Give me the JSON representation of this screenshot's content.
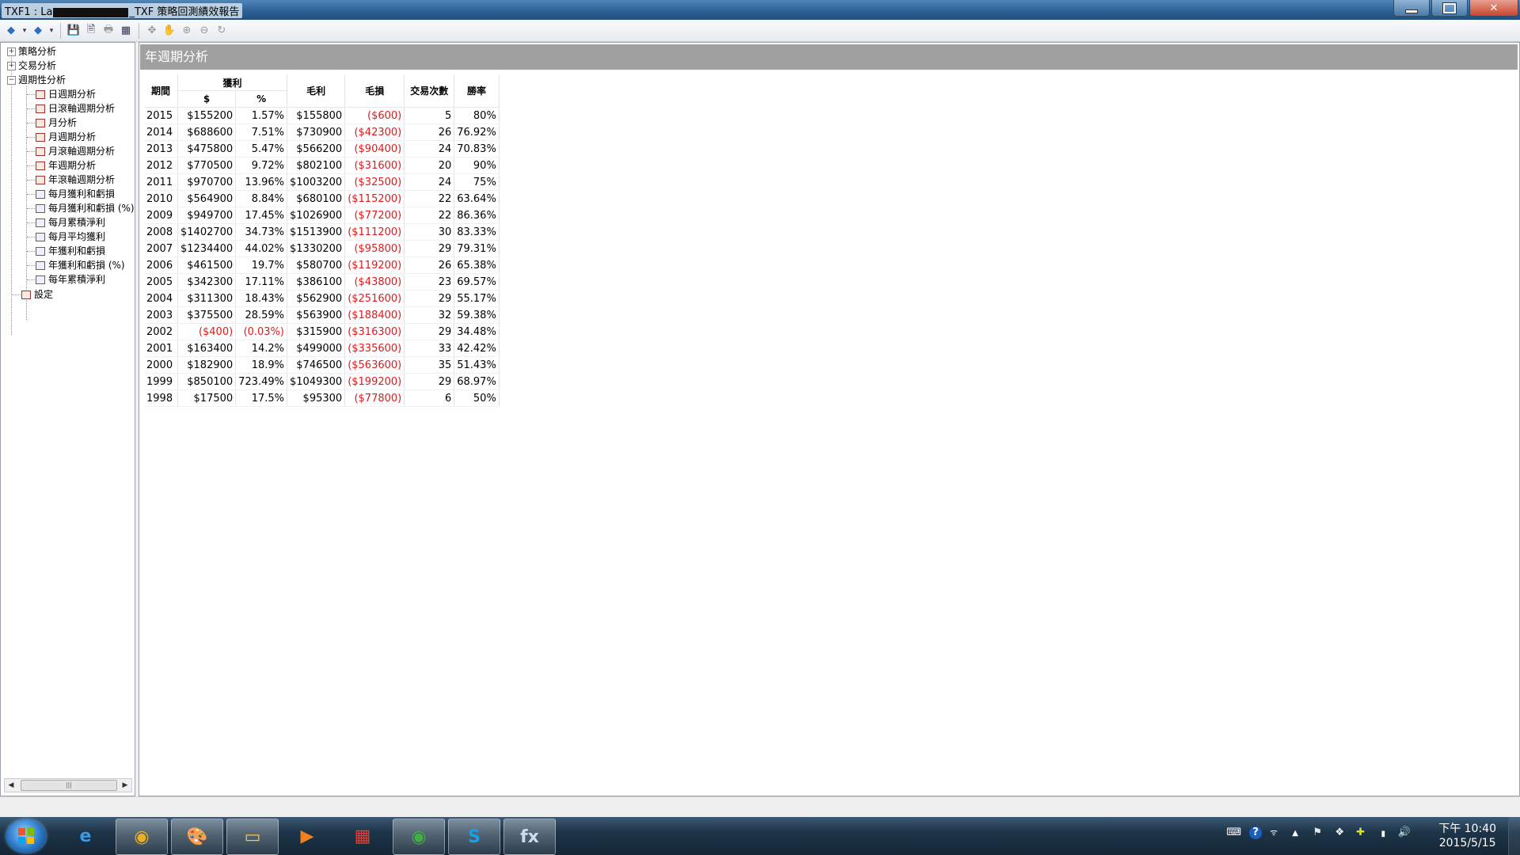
{
  "window": {
    "title_prefix": "TXF1 : La",
    "title_suffix": "_TXF 策略回測績效報告",
    "min_icon": "minimize-icon",
    "max_icon": "maximize-icon",
    "close_glyph": "✕"
  },
  "toolbar": {
    "back_glyph": "◆",
    "forward_glyph": "◆",
    "drop_glyph": "▾",
    "save_glyph": "💾",
    "doc_glyph": "🗎",
    "print_glyph": "🖶",
    "layout_glyph": "▦",
    "arrow_glyph": "✥",
    "hand_glyph": "✋",
    "zoom_in_glyph": "⊕",
    "zoom_out_glyph": "⊖",
    "refresh_glyph": "↻"
  },
  "tree": {
    "roots": [
      {
        "label": "策略分析",
        "exp": "+"
      },
      {
        "label": "交易分析",
        "exp": "+"
      },
      {
        "label": "週期性分析",
        "exp": "−"
      }
    ],
    "children": [
      {
        "label": "日週期分析",
        "icon": "table"
      },
      {
        "label": "日滾軸週期分析",
        "icon": "table"
      },
      {
        "label": "月分析",
        "icon": "table"
      },
      {
        "label": "月週期分析",
        "icon": "table"
      },
      {
        "label": "月滾軸週期分析",
        "icon": "table"
      },
      {
        "label": "年週期分析",
        "icon": "table"
      },
      {
        "label": "年滾軸週期分析",
        "icon": "table"
      },
      {
        "label": "每月獲利和虧損",
        "icon": "chart"
      },
      {
        "label": "每月獲利和虧損 (%)",
        "icon": "chart"
      },
      {
        "label": "每月累積淨利",
        "icon": "chart"
      },
      {
        "label": "每月平均獲利",
        "icon": "chart"
      },
      {
        "label": "年獲利和虧損",
        "icon": "chart"
      },
      {
        "label": "年獲利和虧損 (%)",
        "icon": "chart"
      },
      {
        "label": "每年累積淨利",
        "icon": "chart"
      }
    ],
    "settings": "設定",
    "scroll_left": "◀",
    "scroll_right": "▶",
    "scroll_grip": "|||"
  },
  "report": {
    "title": "年週期分析",
    "headers": {
      "period": "期間",
      "profit": "獲利",
      "profit_dollar": "$",
      "profit_pct": "%",
      "gross_profit": "毛利",
      "gross_loss": "毛損",
      "trades": "交易次數",
      "win_rate": "勝率"
    },
    "rows": [
      [
        "2015",
        "$155200",
        "1.57%",
        "$155800",
        "($600)",
        "5",
        "80%"
      ],
      [
        "2014",
        "$688600",
        "7.51%",
        "$730900",
        "($42300)",
        "26",
        "76.92%"
      ],
      [
        "2013",
        "$475800",
        "5.47%",
        "$566200",
        "($90400)",
        "24",
        "70.83%"
      ],
      [
        "2012",
        "$770500",
        "9.72%",
        "$802100",
        "($31600)",
        "20",
        "90%"
      ],
      [
        "2011",
        "$970700",
        "13.96%",
        "$1003200",
        "($32500)",
        "24",
        "75%"
      ],
      [
        "2010",
        "$564900",
        "8.84%",
        "$680100",
        "($115200)",
        "22",
        "63.64%"
      ],
      [
        "2009",
        "$949700",
        "17.45%",
        "$1026900",
        "($77200)",
        "22",
        "86.36%"
      ],
      [
        "2008",
        "$1402700",
        "34.73%",
        "$1513900",
        "($111200)",
        "30",
        "83.33%"
      ],
      [
        "2007",
        "$1234400",
        "44.02%",
        "$1330200",
        "($95800)",
        "29",
        "79.31%"
      ],
      [
        "2006",
        "$461500",
        "19.7%",
        "$580700",
        "($119200)",
        "26",
        "65.38%"
      ],
      [
        "2005",
        "$342300",
        "17.11%",
        "$386100",
        "($43800)",
        "23",
        "69.57%"
      ],
      [
        "2004",
        "$311300",
        "18.43%",
        "$562900",
        "($251600)",
        "29",
        "55.17%"
      ],
      [
        "2003",
        "$375500",
        "28.59%",
        "$563900",
        "($188400)",
        "32",
        "59.38%"
      ],
      [
        "2002",
        "($400)",
        "(0.03%)",
        "$315900",
        "($316300)",
        "29",
        "34.48%"
      ],
      [
        "2001",
        "$163400",
        "14.2%",
        "$499000",
        "($335600)",
        "33",
        "42.42%"
      ],
      [
        "2000",
        "$182900",
        "18.9%",
        "$746500",
        "($563600)",
        "35",
        "51.43%"
      ],
      [
        "1999",
        "$850100",
        "723.49%",
        "$1049300",
        "($199200)",
        "29",
        "68.97%"
      ],
      [
        "1998",
        "$17500",
        "17.5%",
        "$95300",
        "($77800)",
        "6",
        "50%"
      ]
    ],
    "negative_color": "#e0191b"
  },
  "taskbar": {
    "apps": [
      {
        "name": "internet-explorer-icon",
        "glyph": "e",
        "color": "#3a9ae8",
        "active": false
      },
      {
        "name": "chrome-icon",
        "glyph": "◉",
        "color": "#e8b020",
        "active": true
      },
      {
        "name": "paint-icon",
        "glyph": "🎨",
        "color": "#ddd",
        "active": true
      },
      {
        "name": "file-explorer-icon",
        "glyph": "▭",
        "color": "#f0c850",
        "active": true
      },
      {
        "name": "media-player-icon",
        "glyph": "▶",
        "color": "#f08020",
        "active": false
      },
      {
        "name": "apps-grid-icon",
        "glyph": "▦",
        "color": "#e84030",
        "active": false
      },
      {
        "name": "trading-app-icon",
        "glyph": "◉",
        "color": "#40b040",
        "active": true
      },
      {
        "name": "skype-icon",
        "glyph": "S",
        "color": "#1aa0e8",
        "active": true
      },
      {
        "name": "formula-app-icon",
        "glyph": "fx",
        "color": "#cde",
        "active": true
      }
    ],
    "tray": {
      "keyboard": "⌨",
      "help": "?",
      "wifi_small": "ᯤ",
      "up_arrow": "▲",
      "flag": "⚑",
      "dropbox": "❖",
      "plus": "✚",
      "signal": "▮",
      "volume": "🔊"
    },
    "clock_time": "下午 10:40",
    "clock_date": "2015/5/15"
  }
}
